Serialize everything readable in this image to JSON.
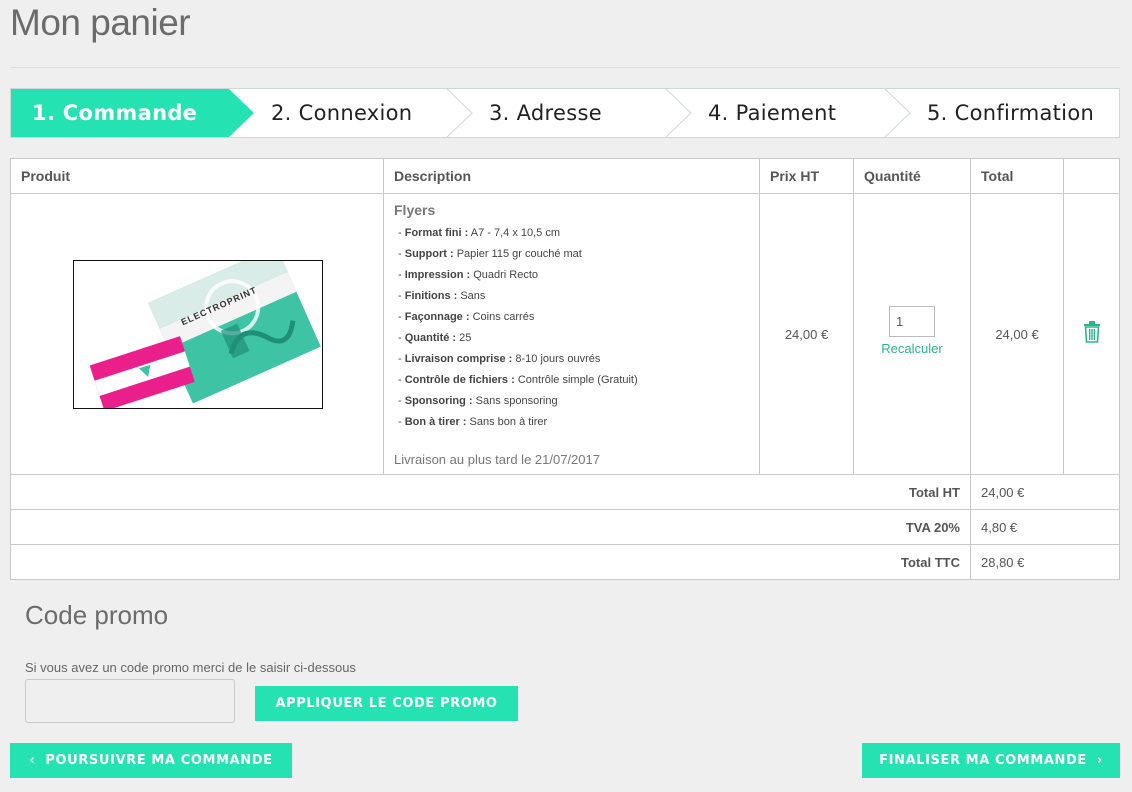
{
  "page": {
    "title": "Mon panier"
  },
  "steps": [
    {
      "label": "1. Commande",
      "active": true
    },
    {
      "label": "2. Connexion",
      "active": false
    },
    {
      "label": "3. Adresse",
      "active": false
    },
    {
      "label": "4. Paiement",
      "active": false
    },
    {
      "label": "5. Confirmation",
      "active": false
    }
  ],
  "table": {
    "headers": [
      "Produit",
      "Description",
      "Prix HT",
      "Quantité",
      "Total"
    ],
    "item": {
      "image_brand_text": "ELECTROPRINT",
      "title": "Flyers",
      "specs": [
        {
          "label": "Format fini :",
          "value": "A7 - 7,4 x 10,5 cm"
        },
        {
          "label": "Support :",
          "value": "Papier 115 gr couché mat"
        },
        {
          "label": "Impression :",
          "value": "Quadri Recto"
        },
        {
          "label": "Finitions :",
          "value": "Sans"
        },
        {
          "label": "Façonnage :",
          "value": "Coins carrés"
        },
        {
          "label": "Quantité :",
          "value": "25"
        },
        {
          "label": "Livraison comprise :",
          "value": "8-10 jours ouvrés"
        },
        {
          "label": "Contrôle de fichiers :",
          "value": "Contrôle simple (Gratuit)"
        },
        {
          "label": "Sponsoring :",
          "value": "Sans sponsoring"
        },
        {
          "label": "Bon à tirer :",
          "value": "Sans bon à tirer"
        }
      ],
      "delivery": "Livraison au plus tard le 21/07/2017",
      "price_ht": "24,00 €",
      "quantity": "1",
      "recalc_label": "Recalculer",
      "total": "24,00 €",
      "delete_icon": "trash-icon"
    },
    "summary": [
      {
        "label": "Total HT",
        "value": "24,00 €"
      },
      {
        "label": "TVA 20%",
        "value": "4,80 €"
      },
      {
        "label": "Total TTC",
        "value": "28,80 €"
      }
    ]
  },
  "promo": {
    "title": "Code promo",
    "hint": "Si vous avez un code promo merci de le saisir ci-dessous",
    "input_value": "",
    "apply_label": "APPLIQUER LE CODE PROMO"
  },
  "nav": {
    "back_label": "POURSUIVRE MA COMMANDE",
    "next_label": "FINALISER MA COMMANDE"
  },
  "colors": {
    "accent": "#25e2b2",
    "link": "#2bb58f",
    "card_pink": "#ea1f8c",
    "card_teal": "#3ec4a5"
  }
}
